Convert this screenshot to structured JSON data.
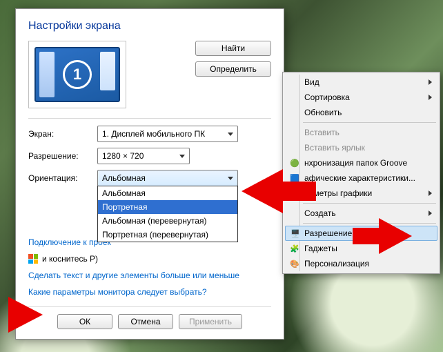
{
  "dialog": {
    "title": "Настройки экрана",
    "find_btn": "Найти",
    "detect_btn": "Определить",
    "monitor_number": "1",
    "labels": {
      "display": "Экран:",
      "resolution": "Разрешение:",
      "orientation": "Ориентация:"
    },
    "display_value": "1. Дисплей мобильного ПК",
    "resolution_value": "1280 × 720",
    "orientation_value": "Альбомная",
    "orientation_options": [
      "Альбомная",
      "Портретная",
      "Альбомная (перевернутая)",
      "Портретная (перевернутая)"
    ],
    "link_projector": "Подключение к проек",
    "hint_projector": "и коснитесь P)",
    "link_textsize": "Сделать текст и другие элементы больше или меньше",
    "link_monitor_params": "Какие параметры монитора следует выбрать?",
    "ok": "ОК",
    "cancel": "Отмена",
    "apply": "Применить",
    "orientation_highlight": 1
  },
  "context_menu": {
    "groups": [
      {
        "label": "Вид",
        "sub": true
      },
      {
        "label": "Сортировка",
        "sub": true
      },
      {
        "label": "Обновить"
      }
    ],
    "paste": "Вставить",
    "paste_shortcut": "Вставить ярлык",
    "groove": "нхронизация папок Groove",
    "graphics": "афические характеристики...",
    "graphics_params": "раметры графики",
    "create": "Создать",
    "resolution": "Разрешение экрана",
    "gadgets": "Гаджеты",
    "personalize": "Персонализация"
  }
}
